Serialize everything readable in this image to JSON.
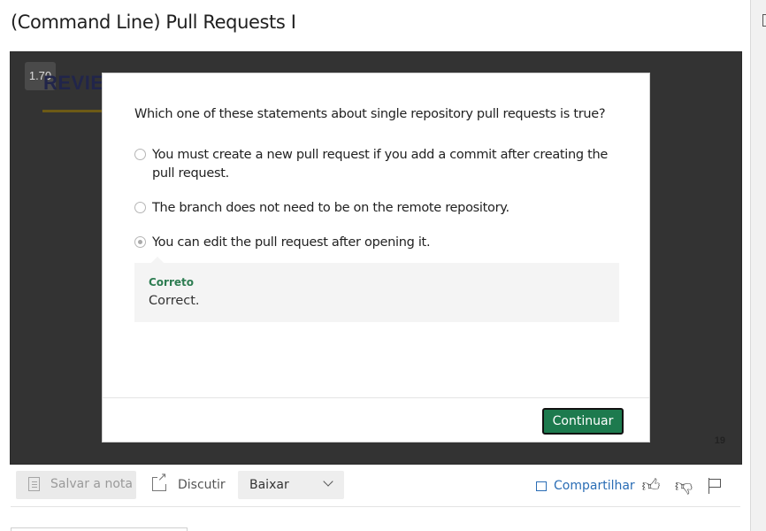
{
  "page": {
    "title": "(Command Line) Pull Requests I"
  },
  "video": {
    "speed": "1.70",
    "slide_heading": "REVIEW",
    "slide_number": "19"
  },
  "quiz": {
    "question": "Which one of these statements about single repository pull requests is true?",
    "options": [
      {
        "text": "You must create a new pull request if you add a commit after creating the pull request.",
        "selected": false
      },
      {
        "text": "The branch does not need to be on the remote repository.",
        "selected": false
      },
      {
        "text": "You can edit the pull request after opening it.",
        "selected": true
      }
    ],
    "feedback": {
      "title": "Correto",
      "text": "Correct."
    },
    "continue_label": "Continuar"
  },
  "toolbar": {
    "save_note_label": "Salvar a nota",
    "discuss_label": "Discutir",
    "download_label": "Baixar",
    "share_label": "Compartilhar"
  },
  "colors": {
    "accent_green": "#1d7a4e",
    "feedback_green": "#2e7d52",
    "link_blue": "#2a6db5"
  },
  "icons": [
    "note-icon",
    "external-link-icon",
    "chevron-down-icon",
    "share-icon",
    "thumbs-up-icon",
    "thumbs-down-icon",
    "flag-icon"
  ]
}
